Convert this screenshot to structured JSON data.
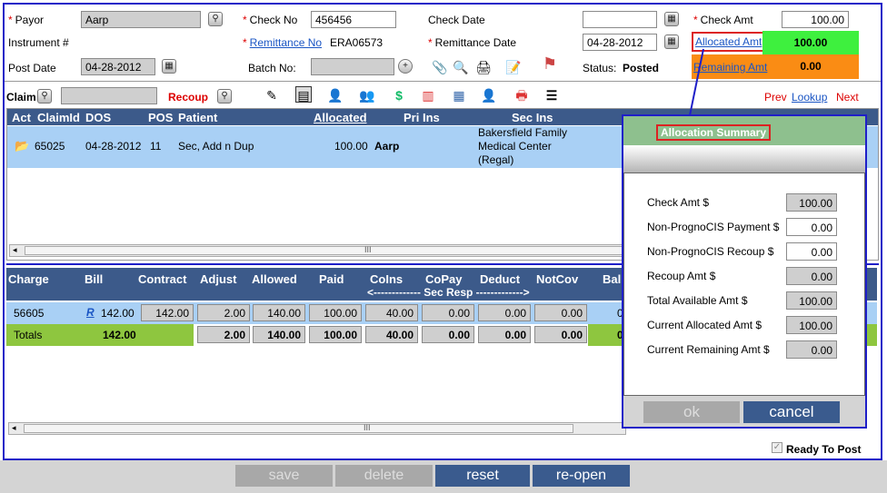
{
  "header": {
    "payor_label": "Payor",
    "payor_value": "Aarp",
    "check_no_label": "Check No",
    "check_no_value": "456456",
    "check_date_label": "Check Date",
    "check_date_value": "",
    "check_amt_label": "Check Amt",
    "check_amt_value": "100.00",
    "instrument_label": "Instrument #",
    "remittance_no_label": "Remittance No",
    "remittance_no_value": "ERA06573",
    "remittance_date_label": "Remittance Date",
    "remittance_date_value": "04-28-2012",
    "allocated_amt_label": "Allocated Amt",
    "allocated_amt_value": "100.00",
    "post_date_label": "Post Date",
    "post_date_value": "04-28-2012",
    "batch_no_label": "Batch No:",
    "batch_no_value": "",
    "status_label": "Status:",
    "status_value": "Posted",
    "remaining_amt_label": "Remaining Amt",
    "remaining_amt_value": "0.00"
  },
  "claimbar": {
    "claim_label": "Claim",
    "claim_value": "",
    "recoup_label": "Recoup",
    "prev": "Prev",
    "lookup": "Lookup",
    "next": "Next"
  },
  "claims_table": {
    "headers": {
      "act": "Act",
      "claimid": "ClaimId",
      "dos": "DOS",
      "pos": "POS",
      "patient": "Patient",
      "allocated": "Allocated",
      "pri_ins": "Pri Ins",
      "sec_ins": "Sec Ins"
    },
    "row": {
      "claimid": "65025",
      "dos": "04-28-2012",
      "pos": "11",
      "patient": "Sec, Add n Dup",
      "allocated": "100.00",
      "pri_ins": "Aarp",
      "sec_ins_1": "Bakersfield Family",
      "sec_ins_2": "Medical Center",
      "sec_ins_3": "(Regal)"
    }
  },
  "charges_table": {
    "headers": {
      "charge": "Charge",
      "bill": "Bill",
      "contract": "Contract",
      "adjust": "Adjust",
      "allowed": "Allowed",
      "paid": "Paid",
      "coins": "CoIns",
      "copay": "CoPay",
      "deduct": "Deduct",
      "notcov": "NotCov",
      "bal": "Bal",
      "sec_resp": "<------------- Sec Resp ------------->"
    },
    "row": {
      "charge": "56605",
      "r": "R",
      "bill": "142.00",
      "contract": "142.00",
      "adjust": "2.00",
      "allowed": "140.00",
      "paid": "100.00",
      "coins": "40.00",
      "copay": "0.00",
      "deduct": "0.00",
      "notcov": "0.00",
      "bal": "0"
    },
    "totals": {
      "label": "Totals",
      "bill": "142.00",
      "adjust": "2.00",
      "allowed": "140.00",
      "paid": "100.00",
      "coins": "40.00",
      "copay": "0.00",
      "deduct": "0.00",
      "notcov": "0.00",
      "bal": "0"
    }
  },
  "ready_to_post": "Ready To Post",
  "footer": {
    "save": "save",
    "delete": "delete",
    "reset": "reset",
    "reopen": "re-open"
  },
  "dialog": {
    "title": "Allocation Summary",
    "rows": [
      {
        "label": "Check Amt $",
        "value": "100.00"
      },
      {
        "label": "Non-PrognoCIS Payment $",
        "value": "0.00"
      },
      {
        "label": "Non-PrognoCIS Recoup $",
        "value": "0.00"
      },
      {
        "label": "Recoup Amt $",
        "value": "0.00"
      },
      {
        "label": "Total Available Amt $",
        "value": "100.00"
      },
      {
        "label": "Current Allocated Amt $",
        "value": "100.00"
      },
      {
        "label": "Current Remaining Amt $",
        "value": "0.00"
      }
    ],
    "ok": "ok",
    "cancel": "cancel"
  },
  "colors": {
    "allocated_bg": "#3ef03e",
    "remaining_bg": "#fa8c14",
    "header_bg": "#3c5a8a",
    "selected_row": "#a9d0f5",
    "totals_row": "#8ec63f",
    "dialog_border": "#1f1fc8"
  }
}
